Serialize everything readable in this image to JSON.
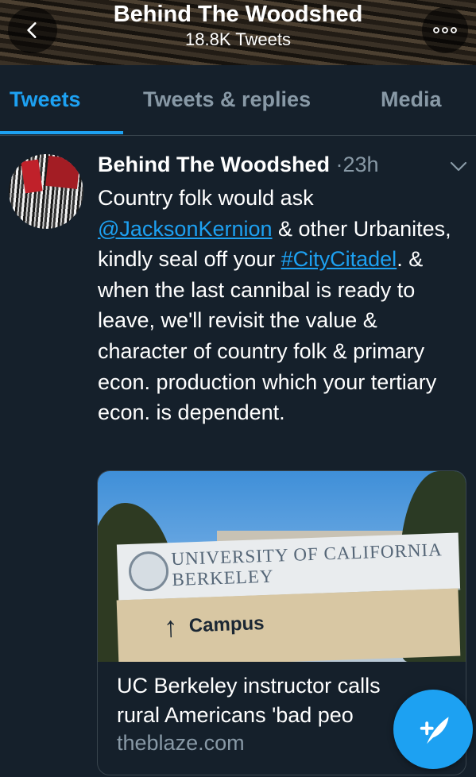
{
  "header": {
    "title": "Behind The Woodshed",
    "subtitle": "18.8K Tweets",
    "back_icon": "chevron-left-icon",
    "more_icon": "more-horizontal-icon"
  },
  "tabs": [
    {
      "label": "Tweets",
      "active": true
    },
    {
      "label": "Tweets & replies",
      "active": false
    },
    {
      "label": "Media",
      "active": false
    }
  ],
  "tweet": {
    "author": "Behind The Woodshed",
    "separator": "·",
    "time": "23h",
    "text_1": "Country folk would ask ",
    "mention": "@JacksonKernion",
    "text_2": " & other Urbanites, kindly seal off your ",
    "hashtag": "#CityCitadel",
    "text_3": ". & when the last cannibal is ready to leave, we'll revisit the value & character of country folk & primary econ. production which your tertiary econ. is dependent."
  },
  "card": {
    "image_sign_line1": "UNIVERSITY OF CALIFORNIA",
    "image_sign_line2": "BERKELEY",
    "image_sign_arrow": "↑",
    "image_sign_campus": "Campus",
    "title_line1": "UC Berkeley instructor calls",
    "title_line2": "rural Americans 'bad peo",
    "domain": "theblaze.com"
  },
  "fab": {
    "icon": "compose-tweet-icon"
  },
  "colors": {
    "background": "#15202b",
    "accent": "#1da1f2",
    "secondary_text": "#8899a6",
    "border": "#38444d"
  }
}
